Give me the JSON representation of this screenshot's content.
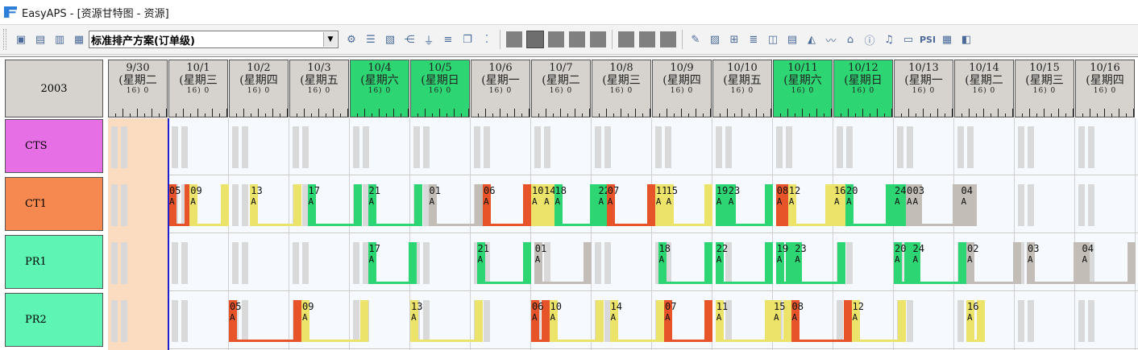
{
  "window": {
    "title": "EasyAPS - [资源甘特图 - 资源]"
  },
  "toolbar": {
    "plan_value": "标准排产方案(订单级)",
    "dropdown_arrow": "▼",
    "buttons_left": [
      {
        "name": "save-icon",
        "glyph": "▣"
      },
      {
        "name": "print-icon",
        "glyph": "▤"
      },
      {
        "name": "preview-icon",
        "glyph": "▥"
      },
      {
        "name": "printer-icon",
        "glyph": "▦"
      }
    ],
    "buttons_mid": [
      {
        "name": "gear-icon",
        "glyph": "⚙"
      },
      {
        "name": "filter-icon",
        "glyph": "☰"
      },
      {
        "name": "document-icon",
        "glyph": "▧"
      },
      {
        "name": "branch-icon",
        "glyph": "⋲"
      },
      {
        "name": "funnel-icon",
        "glyph": "⏚"
      },
      {
        "name": "list-icon",
        "glyph": "≡"
      },
      {
        "name": "copy-icon",
        "glyph": "❐"
      },
      {
        "name": "dots-icon",
        "glyph": "⁚"
      }
    ],
    "buttons_right": [
      {
        "name": "edit-icon",
        "glyph": "✎"
      },
      {
        "name": "report-icon",
        "glyph": "▨"
      },
      {
        "name": "grid-icon",
        "glyph": "⊞"
      },
      {
        "name": "align-icon",
        "glyph": "≣"
      },
      {
        "name": "chart-icon",
        "glyph": "◫"
      },
      {
        "name": "bar-chart-icon",
        "glyph": "▤"
      },
      {
        "name": "area-chart-icon",
        "glyph": "◭"
      },
      {
        "name": "line-chart-icon",
        "glyph": "〰"
      },
      {
        "name": "home-icon",
        "glyph": "⌂"
      },
      {
        "name": "info-icon",
        "glyph": "ⓘ"
      },
      {
        "name": "bell-icon",
        "glyph": "♫"
      },
      {
        "name": "page-icon",
        "glyph": "▭"
      },
      {
        "name": "psi-label",
        "glyph": "PSI"
      },
      {
        "name": "table-icon",
        "glyph": "▦"
      },
      {
        "name": "window-icon",
        "glyph": "◧"
      }
    ]
  },
  "gantt": {
    "corner": "2003",
    "hours_label": "16) 0",
    "days": [
      {
        "date": "9/30",
        "weekday": "(星期二",
        "weekend": false
      },
      {
        "date": "10/1",
        "weekday": "(星期三",
        "weekend": false
      },
      {
        "date": "10/2",
        "weekday": "(星期四",
        "weekend": false
      },
      {
        "date": "10/3",
        "weekday": "(星期五",
        "weekend": false
      },
      {
        "date": "10/4",
        "weekday": "(星期六",
        "weekend": true
      },
      {
        "date": "10/5",
        "weekday": "(星期日",
        "weekend": true
      },
      {
        "date": "10/6",
        "weekday": "(星期一",
        "weekend": false
      },
      {
        "date": "10/7",
        "weekday": "(星期二",
        "weekend": false
      },
      {
        "date": "10/8",
        "weekday": "(星期三",
        "weekend": false
      },
      {
        "date": "10/9",
        "weekday": "(星期四",
        "weekend": false
      },
      {
        "date": "10/10",
        "weekday": "(星期五",
        "weekend": false
      },
      {
        "date": "10/11",
        "weekday": "(星期六",
        "weekend": true
      },
      {
        "date": "10/12",
        "weekday": "(星期日",
        "weekend": true
      },
      {
        "date": "10/13",
        "weekday": "(星期一",
        "weekend": false
      },
      {
        "date": "10/14",
        "weekday": "(星期二",
        "weekend": false
      },
      {
        "date": "10/15",
        "weekday": "(星期三",
        "weekend": false
      },
      {
        "date": "10/16",
        "weekday": "(星期四",
        "weekend": false
      }
    ],
    "colors": {
      "red": "#e8542a",
      "yellow": "#ece36a",
      "green": "#2ed673",
      "gray": "#c3bdb8",
      "idle": "#d9d9d9"
    },
    "resources": [
      {
        "name": "CTS",
        "color": "#e76fe6",
        "jobs": []
      },
      {
        "name": "CT1",
        "color": "#f6894f",
        "jobs": [
          {
            "label": "05",
            "sub": "A",
            "color": "red",
            "start": 1.0,
            "end": 1.4
          },
          {
            "label": "09",
            "sub": "A",
            "color": "yellow",
            "start": 1.35,
            "end": 2.0
          },
          {
            "label": "13",
            "sub": "A",
            "color": "yellow",
            "start": 2.35,
            "end": 3.2
          },
          {
            "label": "17",
            "sub": "A",
            "color": "green",
            "start": 3.3,
            "end": 4.2
          },
          {
            "label": "21",
            "sub": "A",
            "color": "green",
            "start": 4.3,
            "end": 5.2
          },
          {
            "label": "01",
            "sub": "A",
            "color": "gray",
            "start": 5.3,
            "end": 6.2
          },
          {
            "label": "06",
            "sub": "A",
            "color": "red",
            "start": 6.2,
            "end": 7.0
          },
          {
            "label": "10",
            "sub": "A",
            "color": "yellow",
            "start": 7.0,
            "end": 7.2
          },
          {
            "label": "14",
            "sub": "A",
            "color": "yellow",
            "start": 7.2,
            "end": 7.38
          },
          {
            "label": "18",
            "sub": "A",
            "color": "green",
            "start": 7.38,
            "end": 8.1
          },
          {
            "label": "22",
            "sub": "A",
            "color": "green",
            "start": 8.1,
            "end": 8.25
          },
          {
            "label": "07",
            "sub": "A",
            "color": "red",
            "start": 8.25,
            "end": 9.05
          },
          {
            "label": "11",
            "sub": "A",
            "color": "yellow",
            "start": 9.05,
            "end": 9.22
          },
          {
            "label": "15",
            "sub": "A",
            "color": "yellow",
            "start": 9.22,
            "end": 10.0
          },
          {
            "label": "19",
            "sub": "A",
            "color": "green",
            "start": 10.05,
            "end": 10.25
          },
          {
            "label": "23",
            "sub": "A",
            "color": "green",
            "start": 10.25,
            "end": 11.0
          },
          {
            "label": "08",
            "sub": "A",
            "color": "red",
            "start": 11.05,
            "end": 11.25
          },
          {
            "label": "12",
            "sub": "A",
            "color": "yellow",
            "start": 11.25,
            "end": 12.0
          },
          {
            "label": "16",
            "sub": "A",
            "color": "yellow",
            "start": 12.0,
            "end": 12.2
          },
          {
            "label": "20",
            "sub": "A",
            "color": "green",
            "start": 12.2,
            "end": 13.0
          },
          {
            "label": "24",
            "sub": "A",
            "color": "green",
            "start": 13.0,
            "end": 13.2
          },
          {
            "label": "02",
            "sub": "A",
            "color": "gray",
            "start": 13.2,
            "end": 13.3
          },
          {
            "label": "03",
            "sub": "A",
            "color": "gray",
            "start": 13.3,
            "end": 14.1
          },
          {
            "label": "04",
            "sub": "A",
            "color": "gray",
            "start": 14.1,
            "end": 14.35
          }
        ]
      },
      {
        "name": "PR1",
        "color": "#5ef5b4",
        "jobs": [
          {
            "label": "17",
            "sub": "A",
            "color": "green",
            "start": 4.3,
            "end": 5.1
          },
          {
            "label": "21",
            "sub": "A",
            "color": "green",
            "start": 6.1,
            "end": 7.0
          },
          {
            "label": "01",
            "sub": "A",
            "color": "gray",
            "start": 7.05,
            "end": 8.0
          },
          {
            "label": "18",
            "sub": "A",
            "color": "green",
            "start": 9.1,
            "end": 10.0
          },
          {
            "label": "22",
            "sub": "A",
            "color": "green",
            "start": 10.05,
            "end": 11.0
          },
          {
            "label": "19",
            "sub": "A",
            "color": "green",
            "start": 11.05,
            "end": 11.35
          },
          {
            "label": "23",
            "sub": "A",
            "color": "green",
            "start": 11.35,
            "end": 12.2
          },
          {
            "label": "20",
            "sub": "A",
            "color": "green",
            "start": 13.0,
            "end": 13.3
          },
          {
            "label": "24",
            "sub": "A",
            "color": "green",
            "start": 13.3,
            "end": 14.2
          },
          {
            "label": "02",
            "sub": "A",
            "color": "gray",
            "start": 14.2,
            "end": 15.1
          },
          {
            "label": "03",
            "sub": "A",
            "color": "gray",
            "start": 15.2,
            "end": 16.1
          },
          {
            "label": "04",
            "sub": "A",
            "color": "gray",
            "start": 16.1,
            "end": 17.0
          }
        ]
      },
      {
        "name": "PR2",
        "color": "#5ef5b4",
        "jobs": [
          {
            "label": "05",
            "sub": "A",
            "color": "red",
            "start": 2.0,
            "end": 3.2
          },
          {
            "label": "09",
            "sub": "A",
            "color": "yellow",
            "start": 3.2,
            "end": 4.3
          },
          {
            "label": "13",
            "sub": "A",
            "color": "yellow",
            "start": 5.0,
            "end": 6.2
          },
          {
            "label": "06",
            "sub": "A",
            "color": "red",
            "start": 7.0,
            "end": 7.3
          },
          {
            "label": "10",
            "sub": "A",
            "color": "yellow",
            "start": 7.3,
            "end": 8.2
          },
          {
            "label": "14",
            "sub": "A",
            "color": "yellow",
            "start": 8.3,
            "end": 9.2
          },
          {
            "label": "07",
            "sub": "A",
            "color": "red",
            "start": 9.2,
            "end": 10.0
          },
          {
            "label": "11",
            "sub": "A",
            "color": "yellow",
            "start": 10.05,
            "end": 11.0
          },
          {
            "label": "15",
            "sub": "A",
            "color": "yellow",
            "start": 11.0,
            "end": 11.3
          },
          {
            "label": "08",
            "sub": "A",
            "color": "red",
            "start": 11.3,
            "end": 12.3
          },
          {
            "label": "12",
            "sub": "A",
            "color": "yellow",
            "start": 12.3,
            "end": 13.2
          },
          {
            "label": "16",
            "sub": "A",
            "color": "yellow",
            "start": 14.2,
            "end": 14.5
          }
        ]
      }
    ]
  }
}
